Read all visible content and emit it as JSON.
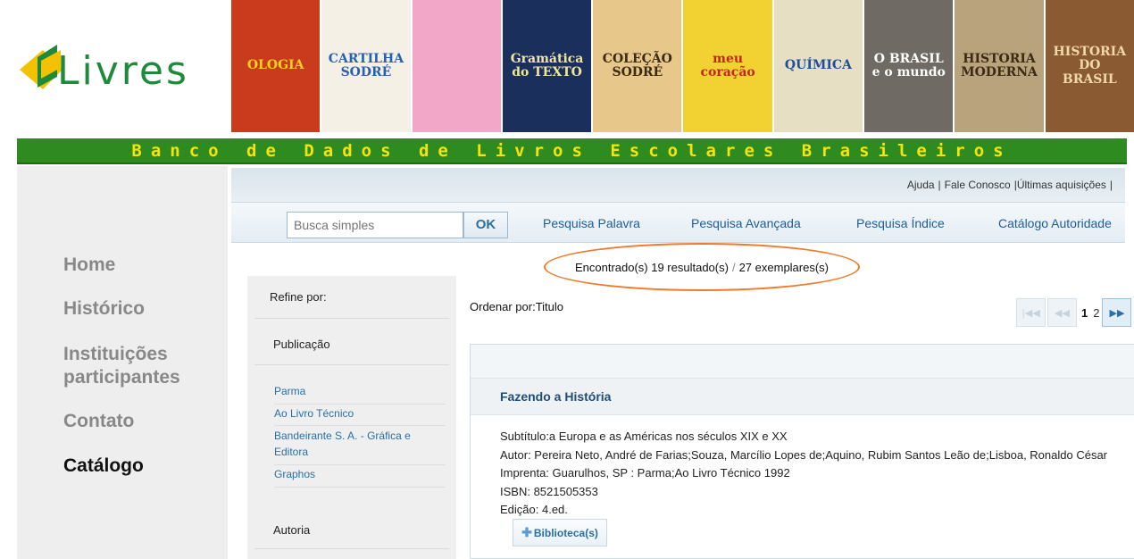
{
  "header": {
    "logo_text": "Livres",
    "banner": "Banco de Dados de Livros Escolares Brasileiros",
    "covers": [
      {
        "text": "OLOGIA",
        "bg": "#c93b1c",
        "fg": "#ffd21f"
      },
      {
        "text": "CARTILHA SODRÉ",
        "bg": "#f4f0e6",
        "fg": "#2a5fb0"
      },
      {
        "text": "",
        "bg": "#f2a7c8",
        "fg": "#6a1a3a"
      },
      {
        "text": "Gramática do TEXTO",
        "bg": "#1a2f5c",
        "fg": "#f0e6a0"
      },
      {
        "text": "COLEÇÃO SODRÉ",
        "bg": "#e8c88a",
        "fg": "#3a2a10"
      },
      {
        "text": "meu coração",
        "bg": "#f2d233",
        "fg": "#c0261c"
      },
      {
        "text": "QUÍMICA",
        "bg": "#e6dfc4",
        "fg": "#1d4f9a"
      },
      {
        "text": "O BRASIL e o mundo",
        "bg": "#6f6a63",
        "fg": "#ffffff"
      },
      {
        "text": "HISTORIA MODERNA",
        "bg": "#b9a37c",
        "fg": "#3b2a14"
      },
      {
        "text": "HISTORIA DO BRASIL",
        "bg": "#8a5a32",
        "fg": "#f0d8a8"
      }
    ]
  },
  "sidebar": {
    "items": [
      {
        "label": "Home",
        "active": false
      },
      {
        "label": "Histórico",
        "active": false
      },
      {
        "label": "Instituições participantes",
        "active": false
      },
      {
        "label": "Contato",
        "active": false
      },
      {
        "label": "Catálogo",
        "active": true
      }
    ]
  },
  "toplinks": {
    "help": "Ajuda",
    "contact": "Fale Conosco",
    "latest": "|Últimas aquisições",
    "sep": "|"
  },
  "search": {
    "placeholder": "Busca simples",
    "ok_label": "OK"
  },
  "nav": {
    "word": "Pesquisa Palavra",
    "advanced": "Pesquisa Avançada",
    "index": "Pesquisa Índice",
    "authority": "Catálogo Autoridade"
  },
  "results": {
    "found": "Encontrado(s) 19 resultado(s)",
    "sep": "/",
    "copies": "27 exemplares(s)"
  },
  "refine": {
    "title": "Refine por:",
    "publication": "Publicação",
    "publishers": [
      "Parma",
      "Ao Livro Técnico",
      "Bandeirante S. A. - Gráfica e Editora",
      "Graphos"
    ],
    "authorship": "Autoria"
  },
  "sort": {
    "label": "Ordenar por:Titulo"
  },
  "pager": {
    "first": "|◀◀",
    "prev": "◀◀",
    "page1": "1",
    "page2": "2",
    "next": "▶▶"
  },
  "record": {
    "title": "Fazendo a História",
    "subtitle": "Subtítulo:a Europa e as Américas nos séculos XIX e XX",
    "author": "Autor: Pereira Neto, André de Farias;Souza, Marcílio Lopes de;Aquino, Rubim Santos Leão de;Lisboa, Ronaldo César",
    "imprint": "Imprenta: Guarulhos, SP : Parma;Ao Livro Técnico 1992",
    "isbn": "ISBN: 8521505353",
    "edition": "Edição: 4.ed.",
    "library_button": "Biblioteca(s)",
    "plus": "✚"
  },
  "colors": {
    "banner_green": "#2e8b1f",
    "banner_text": "#f6e30a",
    "link_blue": "#2a6fa8",
    "highlight_orange": "#f07a2a"
  }
}
